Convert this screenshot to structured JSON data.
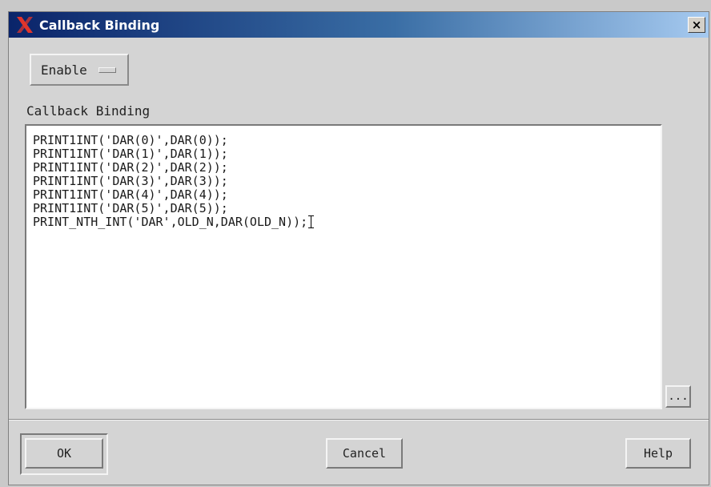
{
  "window": {
    "title": "Callback Binding",
    "close_label": "×"
  },
  "enable_menu": {
    "label": "Enable"
  },
  "callback_section": {
    "label": "Callback Binding",
    "lines": [
      "PRINT1INT('DAR(0)',DAR(0));",
      "PRINT1INT('DAR(1)',DAR(1));",
      "PRINT1INT('DAR(2)',DAR(2));",
      "PRINT1INT('DAR(3)',DAR(3));",
      "PRINT1INT('DAR(4)',DAR(4));",
      "PRINT1INT('DAR(5)',DAR(5));",
      "PRINT_NTH_INT('DAR',OLD_N,DAR(OLD_N));"
    ],
    "more_button_label": "..."
  },
  "buttons": {
    "ok": "OK",
    "cancel": "Cancel",
    "help": "Help"
  },
  "colors": {
    "title_gradient_start": "#0a246a",
    "title_gradient_end": "#a6caf0",
    "title_icon": "#e0352b",
    "window_bg": "#d4d4d4"
  },
  "icons": {
    "title_icon": "x-logo-icon",
    "caret": "text-cursor-icon"
  }
}
